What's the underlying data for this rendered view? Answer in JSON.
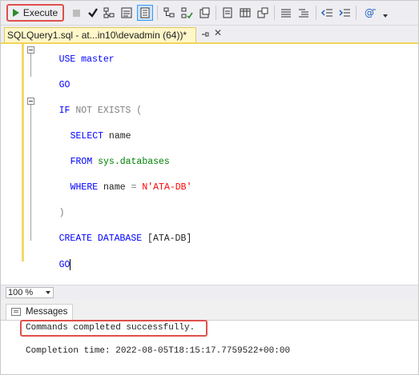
{
  "toolbar": {
    "execute_label": "Execute",
    "icons": [
      "play-icon",
      "stop-icon",
      "parse-checkmark-icon",
      "estimated-plan-icon",
      "results-to-text-icon",
      "results-to-grid-icon",
      "include-plan-icon",
      "live-stats-icon",
      "client-stats-icon",
      "display-plan-icon",
      "results-file-icon",
      "results-grid-icon",
      "results-text-icon",
      "comment-icon",
      "uncomment-icon",
      "decrease-indent-icon",
      "increase-indent-icon",
      "specify-values-icon",
      "dropdown-chevron-icon"
    ]
  },
  "tab": {
    "title": "SQLQuery1.sql - at...in10\\devadmin (64))*",
    "pin_icon": "pin-icon",
    "close_icon": "close-icon",
    "close_glyph": "✕"
  },
  "editor": {
    "line1": {
      "kw": "USE",
      "rest": " master"
    },
    "line2": {
      "kw": "GO"
    },
    "line3": {
      "kw": "IF",
      "not": " NOT EXISTS",
      "paren": " ("
    },
    "line4": {
      "kw": "SELECT",
      "rest": " name"
    },
    "line5": {
      "kw": "FROM",
      "rest": " sys.databases"
    },
    "line6": {
      "kw": "WHERE",
      "rest1": " name ",
      "eq": "=",
      "str": " N'ATA-DB'"
    },
    "line7": {
      "paren": ")"
    },
    "line8": {
      "kw": "CREATE DATABASE",
      "rest": " [ATA-DB]"
    },
    "line9": {
      "kw": "GO"
    }
  },
  "zoom": {
    "value": "100 %"
  },
  "results": {
    "tab_label": "Messages",
    "message": "Commands completed successfully.",
    "completion_time": "Completion time: 2022-08-05T18:15:17.7759522+00:00"
  },
  "colors": {
    "keyword": "#0000ff",
    "gray": "#808080",
    "system_object": "#008000",
    "string": "#ff0000",
    "highlight": "#e0504a",
    "tab_active": "#fff7c9"
  }
}
